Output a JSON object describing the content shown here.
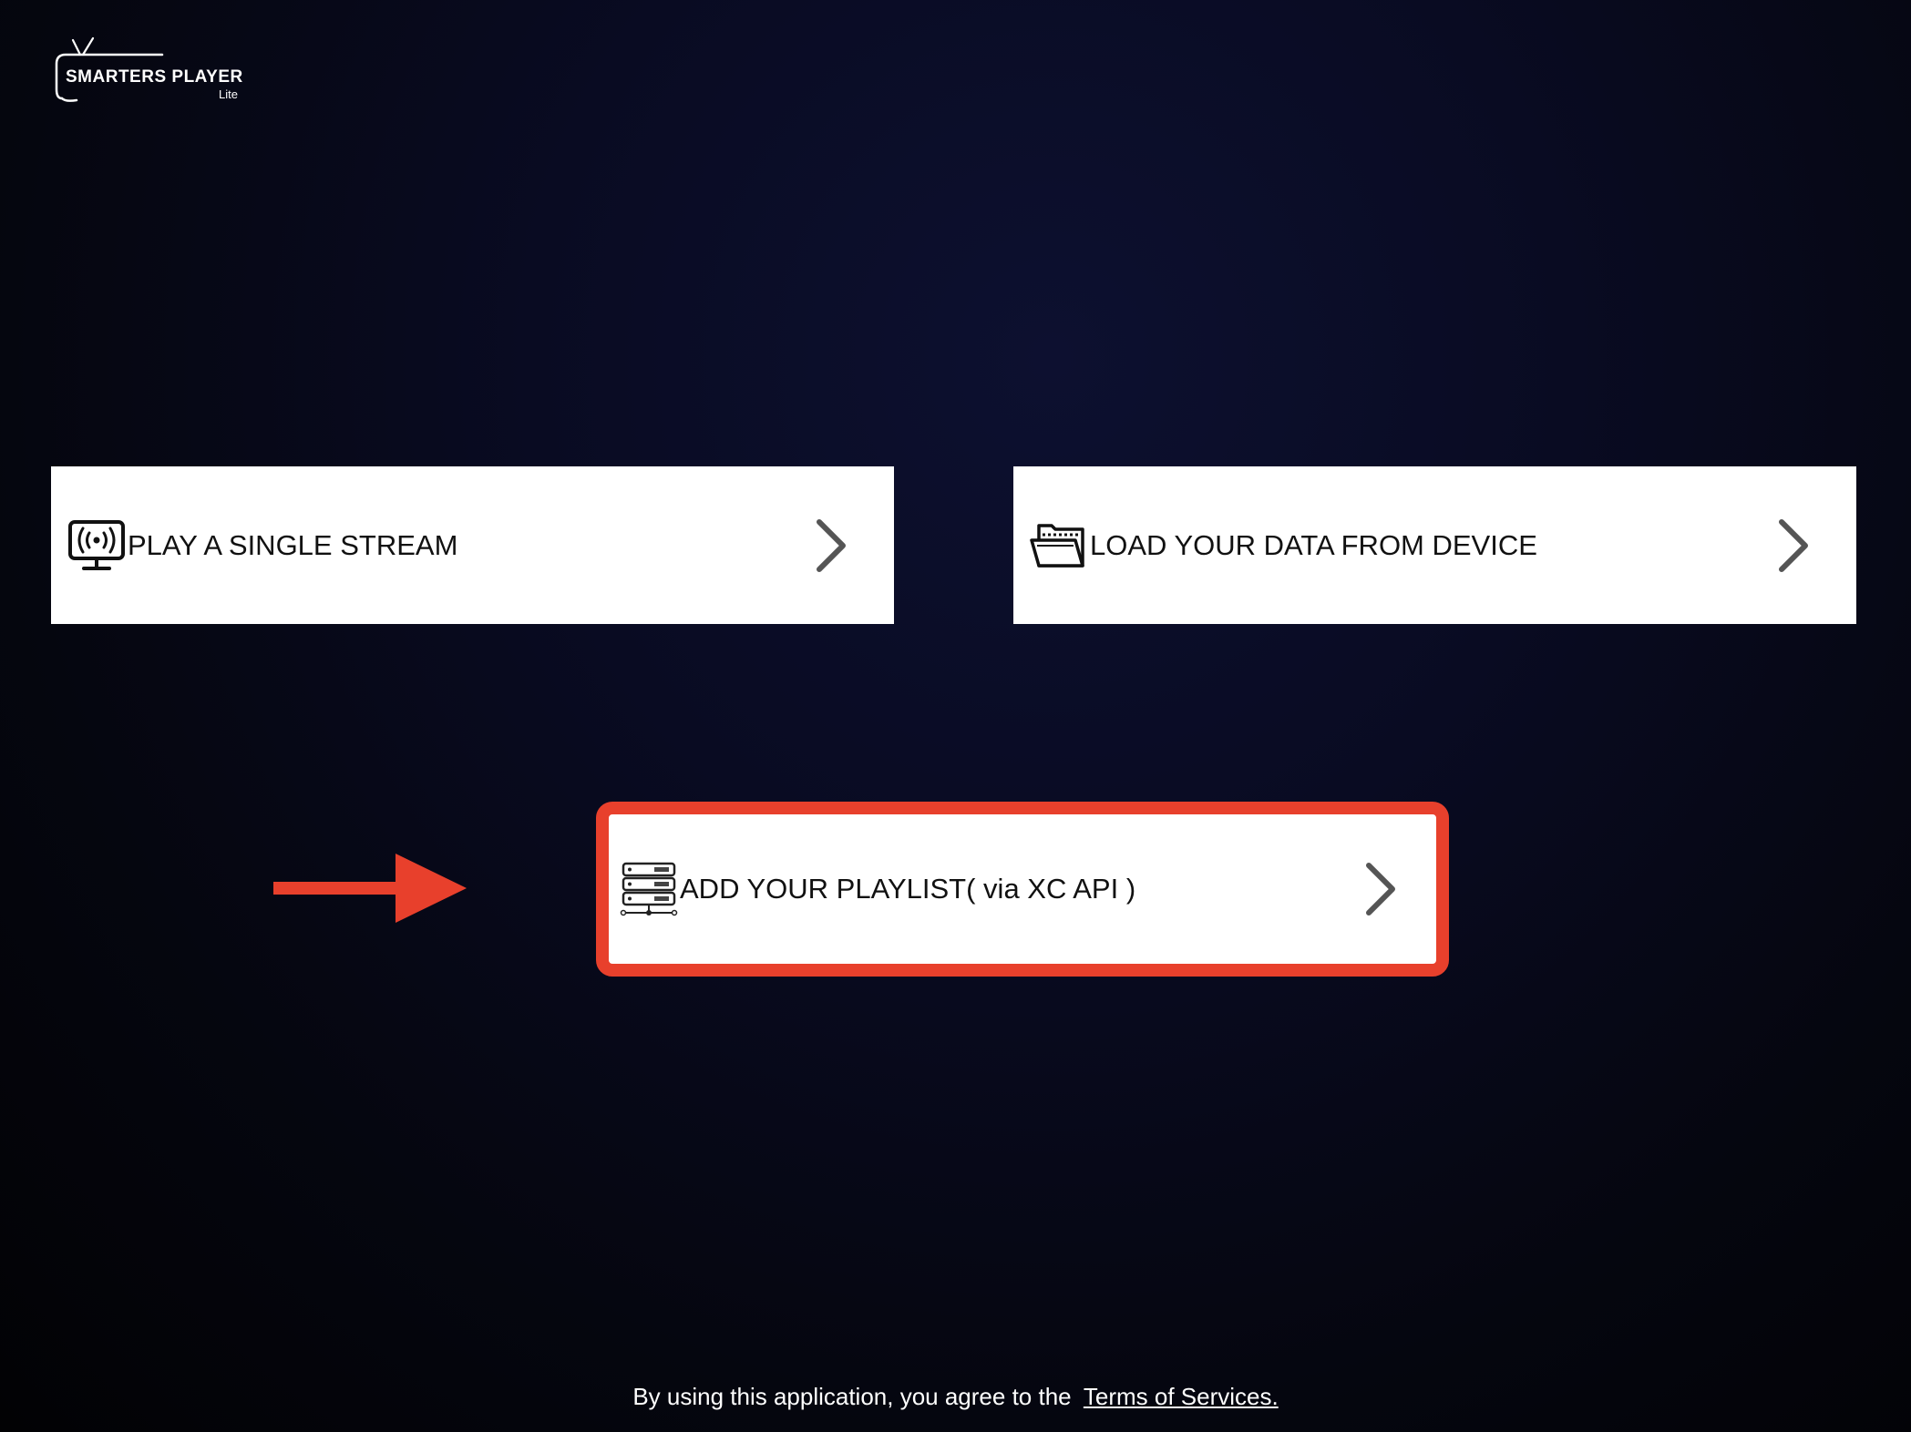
{
  "logo": {
    "name": "SMARTERS PLAYER",
    "edition": "Lite"
  },
  "options": [
    {
      "label": "PLAY A SINGLE STREAM",
      "icon": "broadcast-monitor-icon"
    },
    {
      "label": "LOAD YOUR DATA FROM DEVICE",
      "icon": "open-folder-icon"
    },
    {
      "label": "ADD YOUR PLAYLIST( via XC API )",
      "icon": "server-stack-icon"
    }
  ],
  "highlight": {
    "color": "#e8402c",
    "pointer_icon": "arrow-right-icon"
  },
  "footer": {
    "text": "By using this application, you agree to the",
    "link_label": "Terms of Services."
  }
}
